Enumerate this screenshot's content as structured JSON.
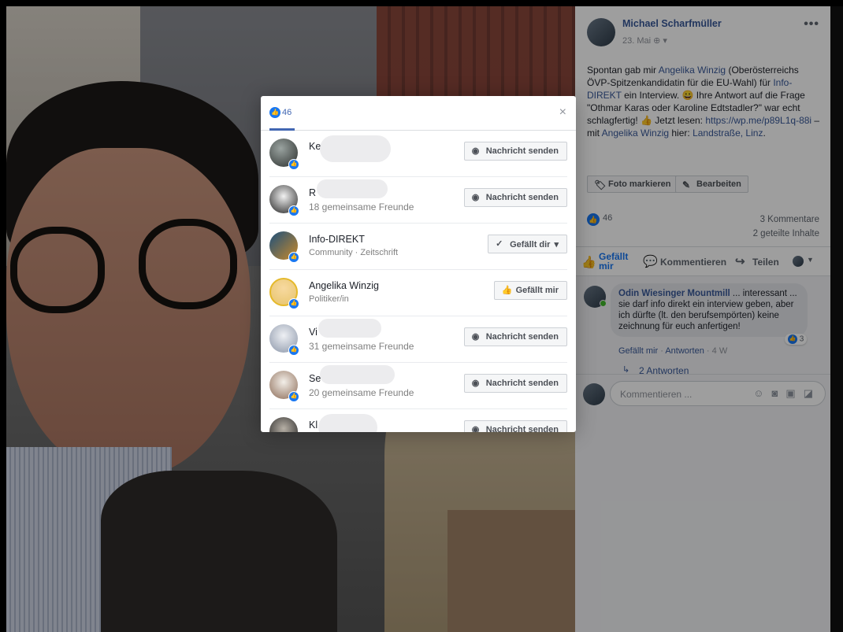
{
  "post": {
    "author": "Michael Scharfmüller",
    "date": "23. Mai",
    "audience_icon": "globe-icon",
    "more": "•••",
    "text_parts": [
      {
        "t": "Spontan gab mir ",
        "link": false
      },
      {
        "t": "Angelika Winzig",
        "link": true
      },
      {
        "t": " (Oberösterreichs ÖVP-Spitzenkandidatin für die EU-Wahl) für ",
        "link": false
      },
      {
        "t": "Info-DIREKT",
        "link": true
      },
      {
        "t": " ein Interview. 😀 Ihre Antwort auf die Frage \"Othmar Karas oder Karoline Edtstadler?\" war echt schlagfertig! 👍 Jetzt lesen: ",
        "link": false
      },
      {
        "t": "https://wp.me/p89L1q-88i",
        "link": true
      },
      {
        "t": " – mit ",
        "link": false
      },
      {
        "t": "Angelika Winzig",
        "link": true
      },
      {
        "t": " hier: ",
        "link": false
      },
      {
        "t": "Landstraße, Linz",
        "link": true
      },
      {
        "t": ".",
        "link": false
      }
    ],
    "tag_photo_label": "Foto markieren",
    "edit_label": "Bearbeiten",
    "like_count": "46",
    "comments_count": "3 Kommentare",
    "shares_count": "2 geteilte Inhalte",
    "actions": {
      "like": "Gefällt mir",
      "comment": "Kommentieren",
      "share": "Teilen"
    }
  },
  "comment": {
    "author": "Odin Wiesinger Mountmill",
    "text": " ... interessant ... sie darf info direkt ein interview geben, aber ich dürfte (lt. den berufsempörten) keine zeichnung für euch anfertigen!",
    "reactions": "3",
    "like": "Gefällt mir",
    "reply": "Antworten",
    "time": "4 W",
    "replies": "2 Antworten"
  },
  "composer": {
    "placeholder": "Kommentieren ...",
    "icons": [
      "emoji-icon",
      "camera-icon",
      "gif-icon",
      "sticker-icon"
    ]
  },
  "modal": {
    "tab_count": "46",
    "close": "×",
    "rows": [
      {
        "name": "Ke",
        "sub": "",
        "button": "Nachricht senden",
        "btn_icon": "messenger-icon",
        "btn_glyph": "◉",
        "blur": [
          14,
          90
        ]
      },
      {
        "name": "R",
        "sub": "18 gemeinsame Freunde",
        "button": "Nachricht senden",
        "btn_icon": "messenger-icon",
        "btn_glyph": "◉",
        "blur": [
          10,
          90
        ]
      },
      {
        "name": "Info-DIREKT",
        "sub": "Community · Zeitschrift",
        "button": "Gefällt dir",
        "btn_icon": "check-icon",
        "btn_glyph": "✓",
        "caret": "▾"
      },
      {
        "name": "Angelika Winzig",
        "sub": "Politiker/in",
        "button": "Gefällt mir",
        "btn_icon": "thumbs-up-icon",
        "btn_glyph": "👍"
      },
      {
        "name": "Vi",
        "sub": "31 gemeinsame Freunde",
        "button": "Nachricht senden",
        "btn_icon": "messenger-icon",
        "btn_glyph": "◉",
        "blur": [
          12,
          80
        ]
      },
      {
        "name": "Se",
        "sub": "20 gemeinsame Freunde",
        "button": "Nachricht senden",
        "btn_icon": "messenger-icon",
        "btn_glyph": "◉",
        "blur": [
          14,
          95
        ]
      },
      {
        "name": "Kl",
        "sub": "",
        "button": "Nachricht senden",
        "btn_icon": "messenger-icon",
        "btn_glyph": "◉",
        "blur": [
          12,
          75
        ]
      }
    ]
  },
  "colors": {
    "facebook_blue": "#1877f2",
    "link": "#385898"
  }
}
